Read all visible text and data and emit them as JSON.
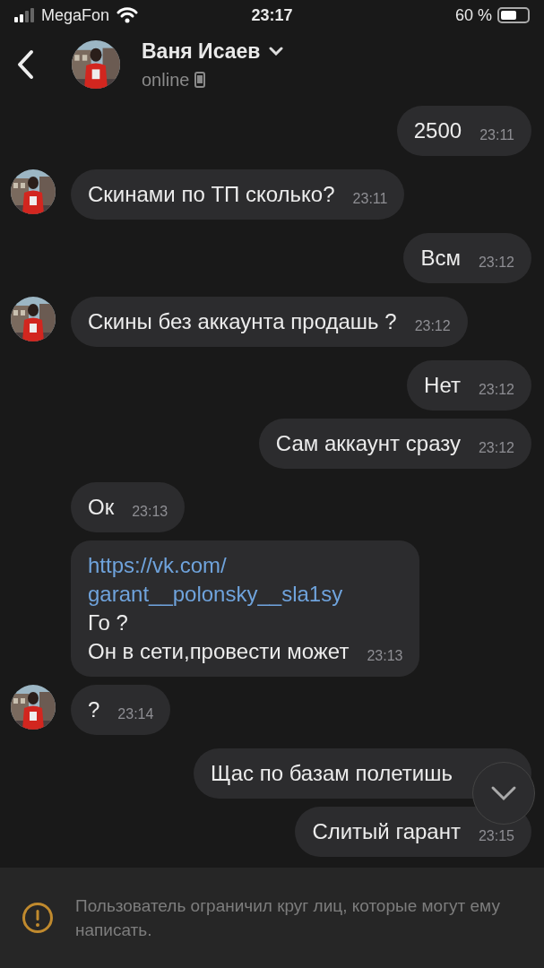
{
  "status_bar": {
    "carrier": "MegaFon",
    "time": "23:17",
    "battery": "60 %"
  },
  "header": {
    "name": "Ваня Исаев",
    "status": "online"
  },
  "messages": [
    {
      "outgoing": true,
      "lines": [
        {
          "kind": "text",
          "text": "2500"
        }
      ],
      "time": "23:11"
    },
    {
      "outgoing": false,
      "avatar": true,
      "lines": [
        {
          "kind": "text",
          "text": "Скинами по ТП сколько?"
        }
      ],
      "time": "23:11"
    },
    {
      "outgoing": true,
      "lines": [
        {
          "kind": "text",
          "text": "Всм"
        }
      ],
      "time": "23:12"
    },
    {
      "outgoing": false,
      "avatar": true,
      "lines": [
        {
          "kind": "text",
          "text": "Скины без аккаунта продашь ?"
        }
      ],
      "time": "23:12"
    },
    {
      "outgoing": true,
      "lines": [
        {
          "kind": "text",
          "text": "Нет"
        }
      ],
      "time": "23:12"
    },
    {
      "outgoing": true,
      "lines": [
        {
          "kind": "text",
          "text": "Сам аккаунт сразу"
        }
      ],
      "time": "23:12"
    },
    {
      "outgoing": false,
      "lines": [
        {
          "kind": "text",
          "text": "Ок"
        }
      ],
      "time": "23:13"
    },
    {
      "outgoing": false,
      "lines": [
        {
          "kind": "link",
          "text": "https://vk.com/"
        },
        {
          "kind": "link",
          "text": "garant__polonsky__sla1sy"
        },
        {
          "kind": "text",
          "text": "Го ?"
        },
        {
          "kind": "text",
          "text": "Он в сети,провести может"
        }
      ],
      "time": "23:13"
    },
    {
      "outgoing": false,
      "avatar": true,
      "lines": [
        {
          "kind": "text",
          "text": "?"
        }
      ],
      "time": "23:14"
    },
    {
      "outgoing": true,
      "lines": [
        {
          "kind": "text",
          "text": "Щас по базам полетишь"
        }
      ]
    },
    {
      "outgoing": true,
      "lines": [
        {
          "kind": "text",
          "text": "Слитый гарант"
        }
      ],
      "time": "23:15"
    }
  ],
  "notice": "Пользователь ограничил круг лиц, которые могут ему написать."
}
